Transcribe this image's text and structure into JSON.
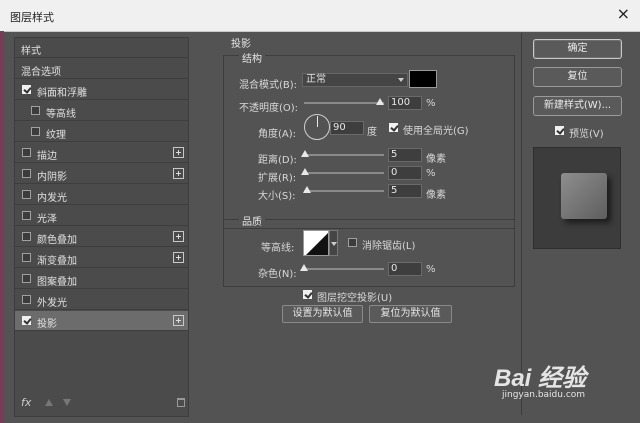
{
  "window": {
    "title": "图层样式",
    "close": "×"
  },
  "left": {
    "items": [
      {
        "label": "样式",
        "checkbox": false,
        "checked": false,
        "plus": false,
        "indent": 0
      },
      {
        "label": "混合选项",
        "checkbox": false,
        "checked": false,
        "plus": false,
        "indent": 0
      },
      {
        "label": "斜面和浮雕",
        "checkbox": true,
        "checked": true,
        "plus": false,
        "indent": 0
      },
      {
        "label": "等高线",
        "checkbox": true,
        "checked": false,
        "plus": false,
        "indent": 1
      },
      {
        "label": "纹理",
        "checkbox": true,
        "checked": false,
        "plus": false,
        "indent": 1
      },
      {
        "label": "描边",
        "checkbox": true,
        "checked": false,
        "plus": true,
        "indent": 0
      },
      {
        "label": "内阴影",
        "checkbox": true,
        "checked": false,
        "plus": true,
        "indent": 0
      },
      {
        "label": "内发光",
        "checkbox": true,
        "checked": false,
        "plus": false,
        "indent": 0
      },
      {
        "label": "光泽",
        "checkbox": true,
        "checked": false,
        "plus": false,
        "indent": 0
      },
      {
        "label": "颜色叠加",
        "checkbox": true,
        "checked": false,
        "plus": true,
        "indent": 0
      },
      {
        "label": "渐变叠加",
        "checkbox": true,
        "checked": false,
        "plus": true,
        "indent": 0
      },
      {
        "label": "图案叠加",
        "checkbox": true,
        "checked": false,
        "plus": false,
        "indent": 0
      },
      {
        "label": "外发光",
        "checkbox": true,
        "checked": false,
        "plus": false,
        "indent": 0
      },
      {
        "label": "投影",
        "checkbox": true,
        "checked": true,
        "plus": true,
        "indent": 0,
        "selected": true
      }
    ],
    "fx": "fx"
  },
  "shadow": {
    "title": "投影",
    "structure_title": "结构",
    "blend_label": "混合模式(B):",
    "blend_value": "正常",
    "blend_color": "#000000",
    "opacity_label": "不透明度(O):",
    "opacity_value": "100",
    "opacity_unit": "%",
    "opacity_fraction": 1.0,
    "angle_label": "角度(A):",
    "angle_value": "90",
    "angle_unit": "度",
    "global_light_label": "使用全局光(G)",
    "global_light_checked": true,
    "distance_label": "距离(D):",
    "distance_value": "5",
    "distance_unit": "像素",
    "spread_label": "扩展(R):",
    "spread_value": "0",
    "spread_unit": "%",
    "size_label": "大小(S):",
    "size_value": "5",
    "size_unit": "像素",
    "quality_title": "品质",
    "contour_label": "等高线:",
    "antialias_label": "消除锯齿(L)",
    "antialias_checked": false,
    "noise_label": "杂色(N):",
    "noise_value": "0",
    "noise_unit": "%",
    "knockout_label": "图层挖空投影(U)",
    "knockout_checked": true,
    "set_default_label": "设置为默认值",
    "reset_default_label": "复位为默认值"
  },
  "right": {
    "ok_label": "确定",
    "reset_label": "复位",
    "new_style_label": "新建样式(W)...",
    "preview_label": "预览(V)",
    "preview_checked": true
  },
  "watermark": {
    "brand": "Bai 经验",
    "url": "jingyan.baidu.com"
  }
}
